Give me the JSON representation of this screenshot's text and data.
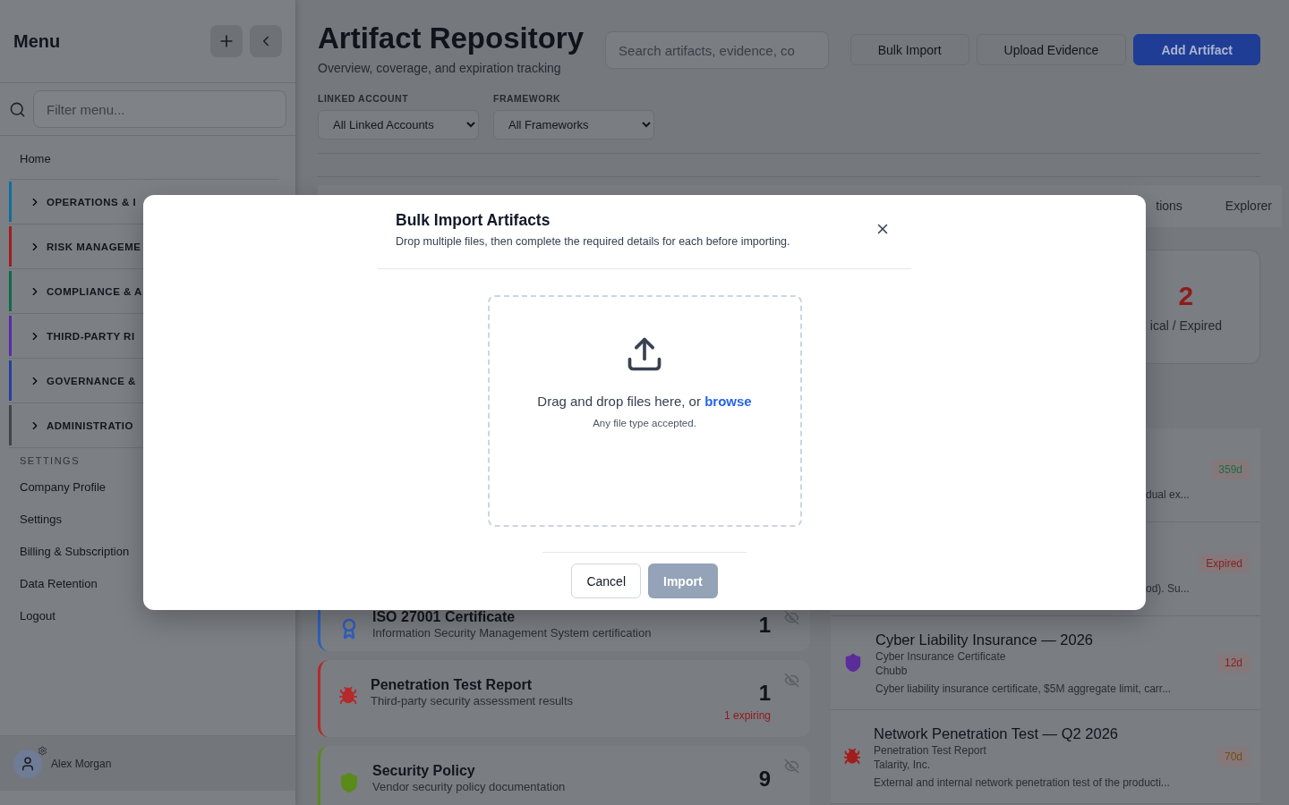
{
  "sidebar": {
    "title": "Menu",
    "filter_placeholder": "Filter menu...",
    "home": "Home",
    "groups": [
      {
        "label": "OPERATIONS & I",
        "color": "#0e6ea0",
        "expanded": false
      },
      {
        "label": "RISK MANAGEME",
        "color": "#a11d1d",
        "expanded": false
      },
      {
        "label": "COMPLIANCE & A",
        "color": "#0b6b4a",
        "expanded": false
      },
      {
        "label": "THIRD-PARTY RI",
        "color": "#5b2aa8",
        "expanded": false
      },
      {
        "label": "GOVERNANCE &",
        "color": "#243f9e",
        "expanded": false
      },
      {
        "label": "ADMINISTRATIO",
        "color": "#3f444b",
        "expanded": false
      }
    ],
    "settings_label": "SETTINGS",
    "settings_links": [
      "Company Profile",
      "Settings",
      "Billing & Subscription",
      "Data Retention",
      "Logout"
    ],
    "user": "Alex Morgan"
  },
  "header": {
    "title": "Artifact Repository",
    "subtitle": "Overview, coverage, and expiration tracking",
    "search_placeholder": "Search artifacts, evidence, co",
    "buttons": [
      {
        "label": "Bulk Import",
        "kind": "secondary"
      },
      {
        "label": "Upload Evidence",
        "kind": "secondary"
      },
      {
        "label": "Add Artifact",
        "kind": "primary"
      }
    ]
  },
  "filters": [
    {
      "label": "LINKED ACCOUNT",
      "value": "All Linked Accounts"
    },
    {
      "label": "FRAMEWORK",
      "value": "All Frameworks"
    }
  ],
  "tabs": [
    {
      "label": "tions",
      "selected": false
    },
    {
      "label": "Explorer",
      "selected": false
    }
  ],
  "stat": {
    "value": "2",
    "label": "ical / Expired"
  },
  "artifact_types": [
    {
      "title": "ISO 27001 Certificate",
      "description": "Information Security Management System certification",
      "count": "1",
      "kind": "certificate",
      "color": "#2f5fbf",
      "hidden": true
    },
    {
      "title": "Penetration Test Report",
      "description": "Third-party security assessment results",
      "count": "1",
      "note": "1 expiring",
      "kind": "report",
      "color": "#b52a2a",
      "hidden": true
    },
    {
      "title": "Security Policy",
      "description": "Vendor security policy documentation",
      "count": "9",
      "kind": "policy",
      "color": "#5a8a1a",
      "hidden": true
    }
  ],
  "artifacts": [
    {
      "kind": "partial",
      "snippet": "dual ex...",
      "badge": "359d",
      "color": "#1f6b46"
    },
    {
      "kind": "partial",
      "snippet": "od). Su...",
      "badge": "Expired",
      "color": "#8b1e1e"
    },
    {
      "kind": "insurance",
      "title": "Cyber Liability Insurance — 2026",
      "type": "Cyber Insurance Certificate",
      "vendor": "Chubb",
      "description": "Cyber liability insurance certificate, $5M aggregate limit, carr...",
      "badge": "12d",
      "color": "#8b1e1e"
    },
    {
      "kind": "pentest",
      "title": "Network Penetration Test — Q2 2026",
      "type": "Penetration Test Report",
      "vendor": "Talarity, Inc.",
      "description": "External and internal network penetration test of the producti...",
      "badge": "70d",
      "color": "#7a4a10"
    }
  ],
  "modal": {
    "title": "Bulk Import Artifacts",
    "subtitle": "Drop multiple files, then complete the required details for each before importing.",
    "drop_text": "Drag and drop files here, or ",
    "browse": "browse",
    "hint": "Any file type accepted.",
    "cancel": "Cancel",
    "import": {
      "label": "Import",
      "disabled": true
    }
  }
}
